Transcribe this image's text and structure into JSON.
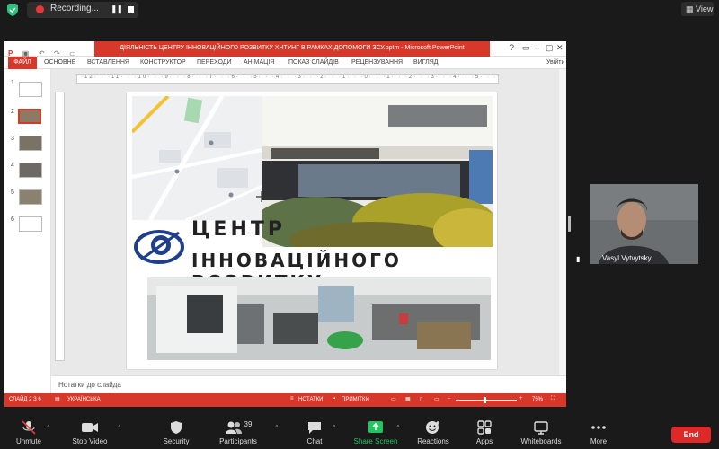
{
  "zoom_top": {
    "recording_label": "Recording...",
    "view_label": "View"
  },
  "ppt": {
    "title": "ДІЯЛЬНІСТЬ ЦЕНТРУ ІННОВАЦІЙНОГО РОЗВИТКУ ХНТУНГ В РАМКАХ ДОПОМОГИ ЗСУ.pptm - Microsoft PowerPoint",
    "file_tab": "ФАЙЛ",
    "tabs": [
      "ОСНОВНЕ",
      "ВСТАВЛЕННЯ",
      "КОНСТРУКТОР",
      "ПЕРЕХОДИ",
      "АНІМАЦІЯ",
      "ПОКАЗ СЛАЙДІВ",
      "РЕЦЕНЗУВАННЯ",
      "ВИГЛЯД"
    ],
    "signin": "Увійти",
    "slide_numbers": [
      "1",
      "2",
      "3",
      "4",
      "5",
      "6"
    ],
    "selected_slide": 2,
    "ruler_text": "·12· · ·11· · ·10· · ·9· · ·8· · ·7· · ·6· · ·5· · ·4· · ·3· · ·2· · ·1· · ·0· · ·1· · ·2· · ·3· · ·4· · ·5· · ·6· · ·7· · ·8· · ·9· · ·10· · ·11· · ·12·",
    "slide": {
      "title_line1": "ЦЕНТР",
      "title_line2": "ІННОВАЦІЙНОГО РОЗВИТКУ"
    },
    "notes_placeholder": "Нотатки до слайда",
    "status": {
      "slide_info": "СЛАЙД 2 З 6",
      "language": "УКРАЇНСЬКА",
      "notes_btn": "НОТАТКИ",
      "comments_btn": "ПРИМІТКИ",
      "zoom": "75%"
    }
  },
  "participant": {
    "name": "Vasyl Vytvytskyi"
  },
  "toolbar": {
    "mute": "Unmute",
    "video": "Stop Video",
    "security": "Security",
    "participants": "Participants",
    "participants_count": "39",
    "chat": "Chat",
    "share": "Share Screen",
    "reactions": "Reactions",
    "apps": "Apps",
    "whiteboards": "Whiteboards",
    "more": "More",
    "end": "End"
  },
  "colors": {
    "ppt_accent": "#d7382a",
    "share_green": "#22c55e",
    "end_red": "#e02828"
  }
}
